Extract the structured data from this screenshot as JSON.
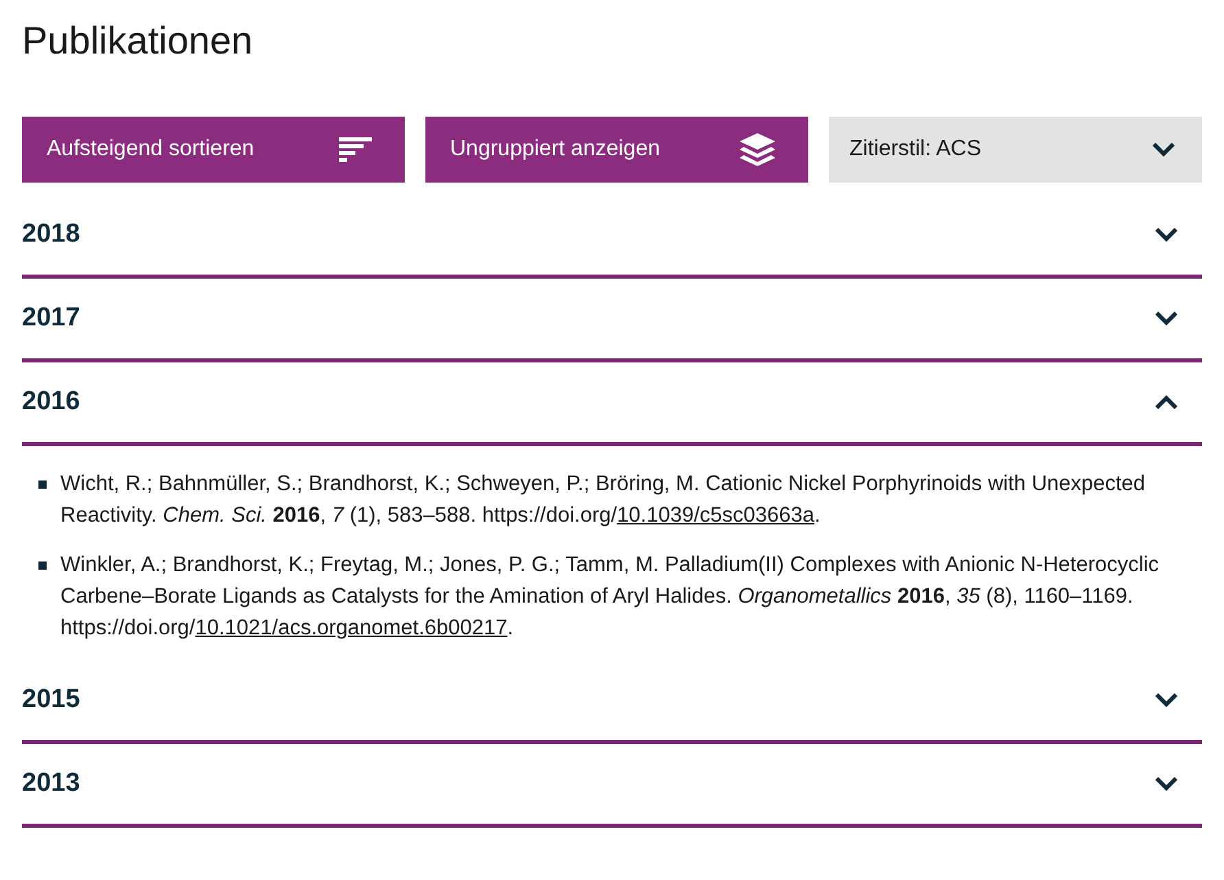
{
  "title": "Publikationen",
  "controls": [
    {
      "kind": "sort",
      "label": "Aufsteigend sortieren"
    },
    {
      "kind": "group",
      "label": "Ungruppiert anzeigen"
    },
    {
      "kind": "select",
      "label": "Zitierstil: ACS"
    }
  ],
  "years": [
    {
      "year": "2018",
      "expanded": false
    },
    {
      "year": "2017",
      "expanded": false
    },
    {
      "year": "2016",
      "expanded": true,
      "publications": [
        {
          "citation": "Wicht, R.; Bahnmüller, S.; Brandhorst, K.; Schweyen, P.; Bröring, M. Cationic Nickel Porphyrinoids with Unexpected Reactivity. *Chem. Sci.* **2016**, *7* (1), 583–588. https://doi.org/",
          "link": "10.1039/c5sc03663a",
          "end": "."
        },
        {
          "citation": "Winkler, A.; Brandhorst, K.; Freytag, M.; Jones, P. G.; Tamm, M. Palladium(II) Complexes with Anionic N-Heterocyclic Carbene–Borate Ligands as Catalysts for the Amination of Aryl Halides. *Organometallics* **2016**, *35* (8), 1160–1169. https://doi.org/",
          "link": "10.1021/acs.organomet.6b00217",
          "end": "."
        }
      ]
    },
    {
      "year": "2015",
      "expanded": false
    },
    {
      "year": "2013",
      "expanded": false
    }
  ]
}
